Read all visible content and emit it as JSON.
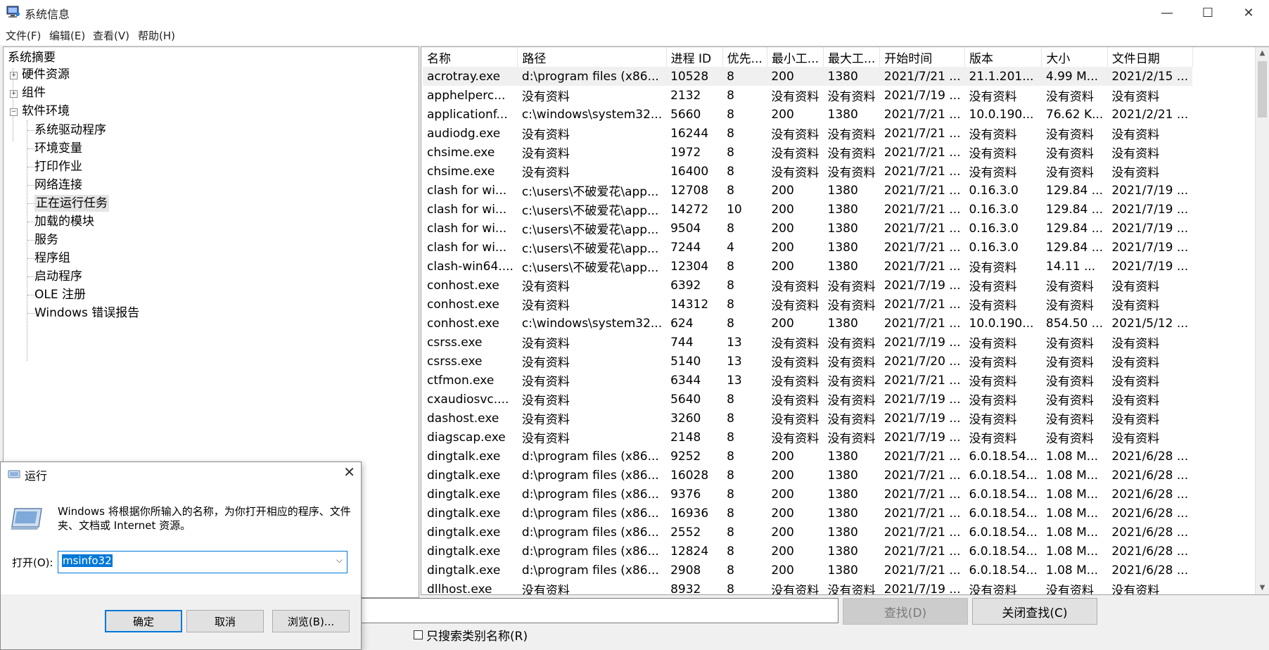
{
  "window": {
    "title": "系统信息",
    "minimize": "—",
    "maximize": "☐",
    "close": "✕"
  },
  "menu": [
    "文件(F)",
    "编辑(E)",
    "查看(V)",
    "帮助(H)"
  ],
  "tree": {
    "root": "系统摘要",
    "nodes": [
      {
        "label": "硬件资源",
        "expander": "+"
      },
      {
        "label": "组件",
        "expander": "+"
      },
      {
        "label": "软件环境",
        "expander": "−"
      }
    ],
    "children": [
      "系统驱动程序",
      "环境变量",
      "打印作业",
      "网络连接",
      "正在运行任务",
      "加载的模块",
      "服务",
      "程序组",
      "启动程序",
      "OLE 注册",
      "Windows 错误报告"
    ],
    "selected": "正在运行任务"
  },
  "table": {
    "headers": [
      "名称",
      "路径",
      "进程 ID",
      "优先...",
      "最小工...",
      "最大工...",
      "开始时间",
      "版本",
      "大小",
      "文件日期"
    ],
    "rows": [
      [
        "acrotray.exe",
        "d:\\program files (x86...",
        "10528",
        "8",
        "200",
        "1380",
        "2021/7/21 ...",
        "21.1.201...",
        "4.99 M...",
        "2021/2/15 ..."
      ],
      [
        "apphelperc...",
        "没有资料",
        "2132",
        "8",
        "没有资料",
        "没有资料",
        "2021/7/19 ...",
        "没有资料",
        "没有资料",
        "没有资料"
      ],
      [
        "applicationf...",
        "c:\\windows\\system32...",
        "5660",
        "8",
        "200",
        "1380",
        "2021/7/21 ...",
        "10.0.190...",
        "76.62 K...",
        "2021/2/21 ..."
      ],
      [
        "audiodg.exe",
        "没有资料",
        "16244",
        "8",
        "没有资料",
        "没有资料",
        "2021/7/21 ...",
        "没有资料",
        "没有资料",
        "没有资料"
      ],
      [
        "chsime.exe",
        "没有资料",
        "1972",
        "8",
        "没有资料",
        "没有资料",
        "2021/7/21 ...",
        "没有资料",
        "没有资料",
        "没有资料"
      ],
      [
        "chsime.exe",
        "没有资料",
        "16400",
        "8",
        "没有资料",
        "没有资料",
        "2021/7/21 ...",
        "没有资料",
        "没有资料",
        "没有资料"
      ],
      [
        "clash for wi...",
        "c:\\users\\不破爱花\\app...",
        "12708",
        "8",
        "200",
        "1380",
        "2021/7/21 ...",
        "0.16.3.0",
        "129.84 ...",
        "2021/7/19 ..."
      ],
      [
        "clash for wi...",
        "c:\\users\\不破爱花\\app...",
        "14272",
        "10",
        "200",
        "1380",
        "2021/7/21 ...",
        "0.16.3.0",
        "129.84 ...",
        "2021/7/19 ..."
      ],
      [
        "clash for wi...",
        "c:\\users\\不破爱花\\app...",
        "9504",
        "8",
        "200",
        "1380",
        "2021/7/21 ...",
        "0.16.3.0",
        "129.84 ...",
        "2021/7/19 ..."
      ],
      [
        "clash for wi...",
        "c:\\users\\不破爱花\\app...",
        "7244",
        "4",
        "200",
        "1380",
        "2021/7/21 ...",
        "0.16.3.0",
        "129.84 ...",
        "2021/7/19 ..."
      ],
      [
        "clash-win64....",
        "c:\\users\\不破爱花\\app...",
        "12304",
        "8",
        "200",
        "1380",
        "2021/7/21 ...",
        "没有资料",
        "14.11 ...",
        "2021/7/19 ..."
      ],
      [
        "conhost.exe",
        "没有资料",
        "6392",
        "8",
        "没有资料",
        "没有资料",
        "2021/7/19 ...",
        "没有资料",
        "没有资料",
        "没有资料"
      ],
      [
        "conhost.exe",
        "没有资料",
        "14312",
        "8",
        "没有资料",
        "没有资料",
        "2021/7/21 ...",
        "没有资料",
        "没有资料",
        "没有资料"
      ],
      [
        "conhost.exe",
        "c:\\windows\\system32...",
        "624",
        "8",
        "200",
        "1380",
        "2021/7/21 ...",
        "10.0.190...",
        "854.50 ...",
        "2021/5/12 ..."
      ],
      [
        "csrss.exe",
        "没有资料",
        "744",
        "13",
        "没有资料",
        "没有资料",
        "2021/7/19 ...",
        "没有资料",
        "没有资料",
        "没有资料"
      ],
      [
        "csrss.exe",
        "没有资料",
        "5140",
        "13",
        "没有资料",
        "没有资料",
        "2021/7/20 ...",
        "没有资料",
        "没有资料",
        "没有资料"
      ],
      [
        "ctfmon.exe",
        "没有资料",
        "6344",
        "13",
        "没有资料",
        "没有资料",
        "2021/7/21 ...",
        "没有资料",
        "没有资料",
        "没有资料"
      ],
      [
        "cxaudiosvc....",
        "没有资料",
        "5640",
        "8",
        "没有资料",
        "没有资料",
        "2021/7/19 ...",
        "没有资料",
        "没有资料",
        "没有资料"
      ],
      [
        "dashost.exe",
        "没有资料",
        "3260",
        "8",
        "没有资料",
        "没有资料",
        "2021/7/19 ...",
        "没有资料",
        "没有资料",
        "没有资料"
      ],
      [
        "diagscap.exe",
        "没有资料",
        "2148",
        "8",
        "没有资料",
        "没有资料",
        "2021/7/19 ...",
        "没有资料",
        "没有资料",
        "没有资料"
      ],
      [
        "dingtalk.exe",
        "d:\\program files (x86...",
        "9252",
        "8",
        "200",
        "1380",
        "2021/7/21 ...",
        "6.0.18.54...",
        "1.08 M...",
        "2021/6/28 ..."
      ],
      [
        "dingtalk.exe",
        "d:\\program files (x86...",
        "16028",
        "8",
        "200",
        "1380",
        "2021/7/21 ...",
        "6.0.18.54...",
        "1.08 M...",
        "2021/6/28 ..."
      ],
      [
        "dingtalk.exe",
        "d:\\program files (x86...",
        "9376",
        "8",
        "200",
        "1380",
        "2021/7/21 ...",
        "6.0.18.54...",
        "1.08 M...",
        "2021/6/28 ..."
      ],
      [
        "dingtalk.exe",
        "d:\\program files (x86...",
        "16936",
        "8",
        "200",
        "1380",
        "2021/7/21 ...",
        "6.0.18.54...",
        "1.08 M...",
        "2021/6/28 ..."
      ],
      [
        "dingtalk.exe",
        "d:\\program files (x86...",
        "2552",
        "8",
        "200",
        "1380",
        "2021/7/21 ...",
        "6.0.18.54...",
        "1.08 M...",
        "2021/6/28 ..."
      ],
      [
        "dingtalk.exe",
        "d:\\program files (x86...",
        "12824",
        "8",
        "200",
        "1380",
        "2021/7/21 ...",
        "6.0.18.54...",
        "1.08 M...",
        "2021/6/28 ..."
      ],
      [
        "dingtalk.exe",
        "d:\\program files (x86...",
        "2908",
        "8",
        "200",
        "1380",
        "2021/7/21 ...",
        "6.0.18.54...",
        "1.08 M...",
        "2021/6/28 ..."
      ],
      [
        "dllhost.exe",
        "没有资料",
        "8932",
        "8",
        "没有资料",
        "没有资料",
        "2021/7/19 ...",
        "没有资料",
        "没有资料",
        "没有资料"
      ]
    ]
  },
  "find": {
    "find_button": "查找(D)",
    "close_find_button": "关闭查找(C)",
    "category_only": "只搜索类别名称(R)"
  },
  "run_dialog": {
    "title": "运行",
    "close": "✕",
    "description": "Windows 将根据你所输入的名称，为你打开相应的程序、文件夹、文档或 Internet 资源。",
    "open_label": "打开(O):",
    "value": "msinfo32",
    "ok": "确定",
    "cancel": "取消",
    "browse": "浏览(B)..."
  },
  "colors": {
    "accent": "#0078d7",
    "selection_bg": "#e5e5e5",
    "dialog_bg": "#f0f0f0"
  }
}
